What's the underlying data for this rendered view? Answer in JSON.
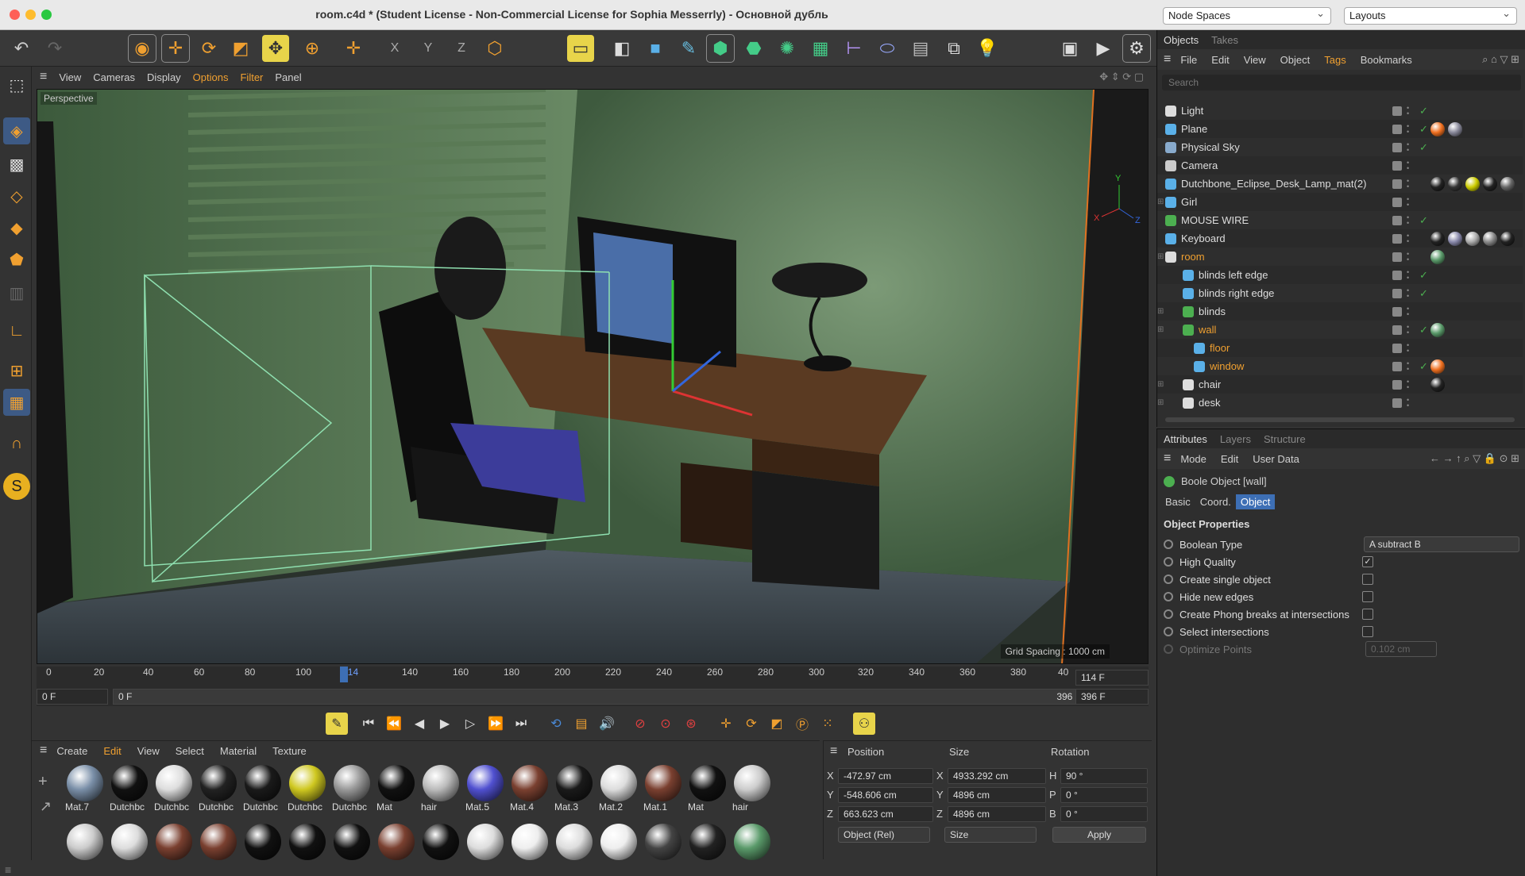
{
  "window": {
    "title": "room.c4d * (Student License - Non-Commercial License for Sophia Messerrly) - Основной дубль"
  },
  "top_right": {
    "node_spaces": "Node Spaces",
    "layouts": "Layouts"
  },
  "viewport_menu": [
    "View",
    "Cameras",
    "Display",
    "Options",
    "Filter",
    "Panel"
  ],
  "viewport": {
    "label": "Perspective",
    "grid_spacing": "Grid Spacing : 1000 cm"
  },
  "timeline": {
    "ticks": [
      "0",
      "20",
      "40",
      "60",
      "80",
      "100",
      "114",
      "140",
      "160",
      "180",
      "200",
      "220",
      "240",
      "260",
      "280",
      "300",
      "320",
      "340",
      "360",
      "380",
      "40"
    ],
    "current_frame": "114 F",
    "start_left": "0 F",
    "start_field": "0 F",
    "end_field": "396 F",
    "end_right": "396 F"
  },
  "material_menu": [
    "Create",
    "Edit",
    "View",
    "Select",
    "Material",
    "Texture"
  ],
  "materials_row1": [
    "Mat.7",
    "Dutchbc",
    "Dutchbc",
    "Dutchbc",
    "Dutchbc",
    "Dutchbc",
    "Dutchbc",
    "Mat",
    "hair",
    "Mat.5",
    "Mat.4",
    "Mat.3",
    "Mat.2",
    "Mat.1",
    "Mat",
    "hair"
  ],
  "coord": {
    "headers": [
      "Position",
      "Size",
      "Rotation"
    ],
    "x_pos": "-472.97 cm",
    "x_size": "4933.292 cm",
    "h_rot": "90 °",
    "y_pos": "-548.606 cm",
    "y_size": "4896 cm",
    "p_rot": "0 °",
    "z_pos": "663.623 cm",
    "z_size": "4896 cm",
    "b_rot": "0 °",
    "labels": {
      "x": "X",
      "y": "Y",
      "z": "Z",
      "sx": "X",
      "sy": "Y",
      "sz": "Z",
      "h": "H",
      "p": "P",
      "b": "B"
    },
    "mode": "Object (Rel)",
    "size_mode": "Size",
    "apply": "Apply"
  },
  "objects_panel": {
    "tabs": [
      "Objects",
      "Takes"
    ],
    "menu": [
      "File",
      "Edit",
      "View",
      "Object",
      "Tags",
      "Bookmarks"
    ],
    "search_placeholder": "Search",
    "items": [
      {
        "name": "Light",
        "indent": 0
      },
      {
        "name": "Plane",
        "indent": 0
      },
      {
        "name": "Physical Sky",
        "indent": 0
      },
      {
        "name": "Camera",
        "indent": 0
      },
      {
        "name": "Dutchbone_Eclipse_Desk_Lamp_mat(2)",
        "indent": 0
      },
      {
        "name": "Girl",
        "indent": 0
      },
      {
        "name": "MOUSE WIRE",
        "indent": 0
      },
      {
        "name": "Keyboard",
        "indent": 0
      },
      {
        "name": "room",
        "indent": 0
      },
      {
        "name": "blinds left edge",
        "indent": 1
      },
      {
        "name": "blinds right edge",
        "indent": 1
      },
      {
        "name": "blinds",
        "indent": 1
      },
      {
        "name": "wall",
        "indent": 1
      },
      {
        "name": "floor",
        "indent": 2
      },
      {
        "name": "window",
        "indent": 2
      },
      {
        "name": "chair",
        "indent": 1
      },
      {
        "name": "desk",
        "indent": 1
      }
    ]
  },
  "attributes_panel": {
    "tabs": [
      "Attributes",
      "Layers",
      "Structure"
    ],
    "menu": [
      "Mode",
      "Edit",
      "User Data"
    ],
    "object_title": "Boole Object [wall]",
    "subtabs": [
      "Basic",
      "Coord.",
      "Object"
    ],
    "section": "Object Properties",
    "properties": [
      {
        "label": "Boolean Type",
        "value": "A subtract B"
      },
      {
        "label": "High Quality",
        "checked": "✓"
      },
      {
        "label": "Create single object"
      },
      {
        "label": "Hide new edges"
      },
      {
        "label": "Create Phong breaks at intersections"
      },
      {
        "label": "Select intersections"
      },
      {
        "label": "Optimize Points",
        "value": "0.102 cm"
      }
    ]
  },
  "colors": {
    "accent": "#f0a030",
    "selected_tab": "#3d6fb5",
    "check": "#4caf50"
  }
}
